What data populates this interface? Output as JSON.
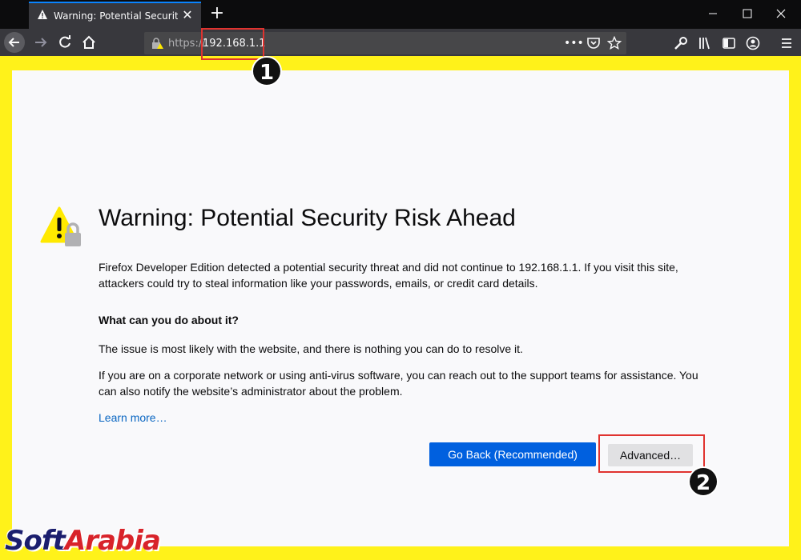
{
  "browser": {
    "tab": {
      "title": "Warning: Potential Security Risk Ahead"
    },
    "address": {
      "protocol": "https://",
      "host": "192.168.1.1"
    }
  },
  "page": {
    "title": "Warning: Potential Security Risk Ahead",
    "intro": "Firefox Developer Edition detected a potential security threat and did not continue to 192.168.1.1. If you visit this site, attackers could try to steal information like your passwords, emails, or credit card details.",
    "subheading": "What can you do about it?",
    "para1": "The issue is most likely with the website, and there is nothing you can do to resolve it.",
    "para2": "If you are on a corporate network or using anti-virus software, you can reach out to the support teams for assistance. You can also notify the website’s administrator about the problem.",
    "learn_more": "Learn more…",
    "go_back_label": "Go Back (Recommended)",
    "advanced_label": "Advanced…"
  },
  "annotations": {
    "step1": "1",
    "step2": "2"
  },
  "watermark": {
    "part1": "Soft",
    "part2": "Arabia"
  },
  "colors": {
    "frame": "#fff21a",
    "accent_blue": "#0060df",
    "annotation_red": "#e0332f"
  },
  "icons": [
    "warning-icon",
    "close-icon",
    "plus-icon",
    "minimize-icon",
    "maximize-icon",
    "back-icon",
    "forward-icon",
    "reload-icon",
    "home-icon",
    "lock-warning-icon",
    "more-icon",
    "pocket-icon",
    "star-icon",
    "wrench-icon",
    "library-icon",
    "sidebar-icon",
    "account-icon",
    "menu-icon"
  ]
}
